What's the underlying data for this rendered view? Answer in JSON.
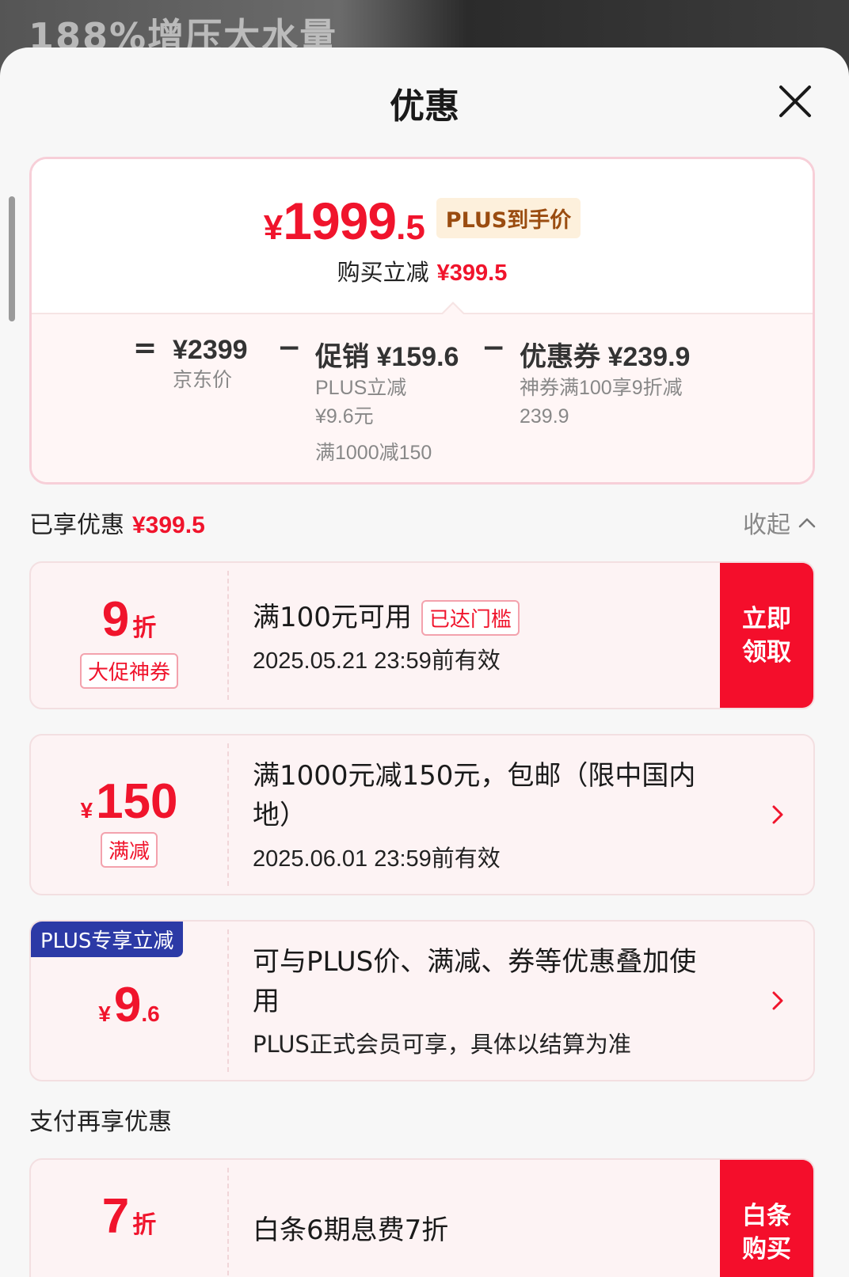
{
  "background": {
    "banner_text": "188%增压大水量"
  },
  "header": {
    "title": "优惠"
  },
  "summary": {
    "price_symbol": "¥",
    "price_integer": "1999",
    "price_decimal": ".5",
    "price_tag": "PLUS到手价",
    "save_label": "购买立减",
    "save_value": "¥399.5",
    "calc": {
      "eq": "=",
      "minus": "−",
      "base_value": "¥2399",
      "base_label": "京东价",
      "promo_value": "促销 ¥159.6",
      "promo_line1": "PLUS立减",
      "promo_line2": "¥9.6元",
      "promo_line3": "满1000减150",
      "coupon_value": "优惠券 ¥239.9",
      "coupon_line1": "神券满100享9折减",
      "coupon_line2": "239.9"
    }
  },
  "enjoyed": {
    "label": "已享优惠",
    "value": "¥399.5",
    "collapse_label": "收起"
  },
  "coupons": [
    {
      "big": "9",
      "unit": "折",
      "tag": "大促神券",
      "title": "满100元可用",
      "status": "已达门槛",
      "date": "2025.05.21 23:59前有效",
      "cta_line1": "立即",
      "cta_line2": "领取"
    },
    {
      "symbol": "¥",
      "big": "150",
      "tag": "满减",
      "title_line1": "满1000元减150元，包邮（限中国内",
      "title_line2": "地）",
      "date": "2025.06.01 23:59前有效"
    },
    {
      "badge": "PLUS专享立减",
      "symbol": "¥",
      "big": "9",
      "decimal": ".6",
      "title_line1": "可与PLUS价、满减、券等优惠叠加使",
      "title_line2": "用",
      "sub": "PLUS正式会员可享，具体以结算为准"
    }
  ],
  "pay": {
    "label": "支付再享优惠",
    "big": "7",
    "unit": "折",
    "title": "白条6期息费7折",
    "cta_line1": "白条",
    "cta_line2": "购买"
  },
  "colors": {
    "accent": "#f0142c",
    "cta": "#f40e2b",
    "plus_badge": "#2c3aa6",
    "price_tag_bg": "#fdf0dc"
  },
  "icons": {
    "close": "close-icon",
    "collapse": "chevron-up-icon",
    "detail": "chevron-right-icon"
  }
}
